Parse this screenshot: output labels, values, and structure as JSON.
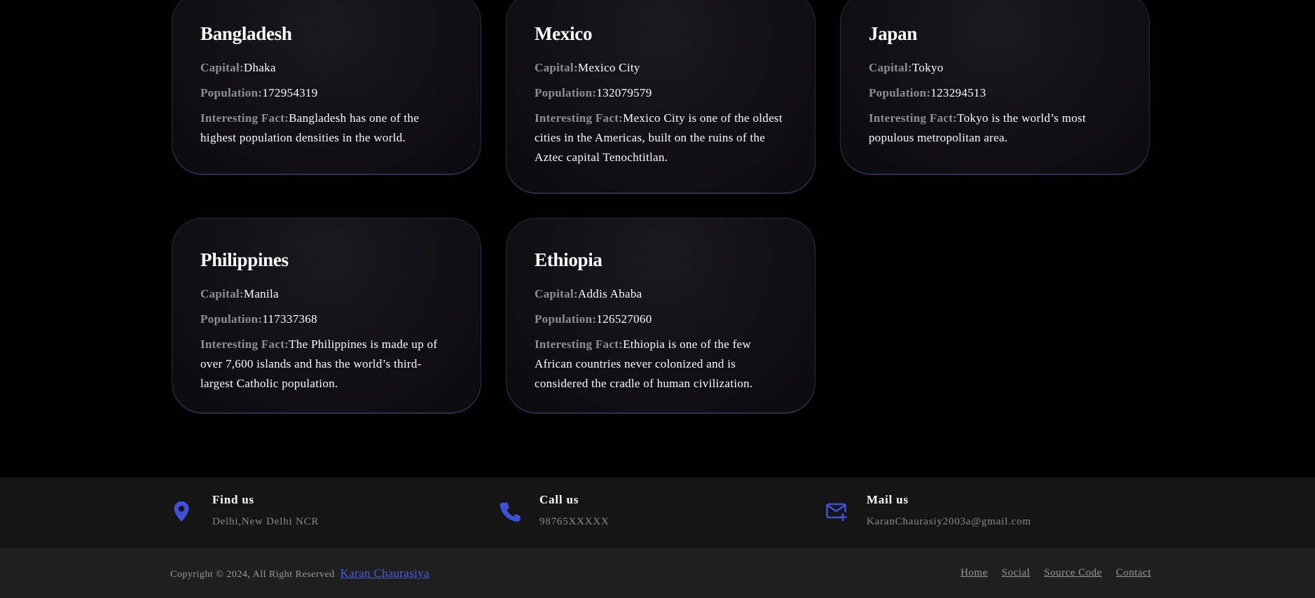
{
  "cards": [
    {
      "name": "Bangladesh",
      "capital_label": "Capital:",
      "capital": "Dhaka",
      "population_label": "Population:",
      "population": "172954319",
      "fact_label": "Interesting Fact:",
      "fact": "Bangladesh has one of the highest population densities in the world."
    },
    {
      "name": "Mexico",
      "capital_label": "Capital:",
      "capital": "Mexico City",
      "population_label": "Population:",
      "population": "132079579",
      "fact_label": "Interesting Fact:",
      "fact": "Mexico City is one of the oldest cities in the Americas, built on the ruins of the Aztec capital Tenochtitlan."
    },
    {
      "name": "Japan",
      "capital_label": "Capital:",
      "capital": "Tokyo",
      "population_label": "Population:",
      "population": "123294513",
      "fact_label": "Interesting Fact:",
      "fact": "Tokyo is the world’s most populous metropolitan area."
    },
    {
      "name": "Philippines",
      "capital_label": "Capital:",
      "capital": "Manila",
      "population_label": "Population:",
      "population": "117337368",
      "fact_label": "Interesting Fact:",
      "fact": "The Philippines is made up of over 7,600 islands and has the world’s third-largest Catholic population."
    },
    {
      "name": "Ethiopia",
      "capital_label": "Capital:",
      "capital": "Addis Ababa",
      "population_label": "Population:",
      "population": "126527060",
      "fact_label": "Interesting Fact:",
      "fact": "Ethiopia is one of the few African countries never colonized and is considered the cradle of human civilization."
    }
  ],
  "footer": {
    "find": {
      "icon": "location-pin-icon",
      "title": "Find us",
      "text": "Delhi,New Delhi NCR"
    },
    "call": {
      "icon": "phone-icon",
      "title": "Call us",
      "text": "98765XXXXX"
    },
    "mail": {
      "icon": "mail-plus-icon",
      "title": "Mail us",
      "text": "KaranChaurasiy2003a@gmail.com"
    },
    "copyright": "Copyright © 2024, All Right Reserved",
    "author": "Karan Chaurasiya",
    "links": [
      "Home",
      "Social",
      "Source Code",
      "Contact"
    ]
  },
  "colors": {
    "accent": "#3f51d6",
    "background": "#000000",
    "info_bar": "#151515",
    "bottom_bar": "#1f1f1f",
    "muted_label": "#8f8f95"
  }
}
